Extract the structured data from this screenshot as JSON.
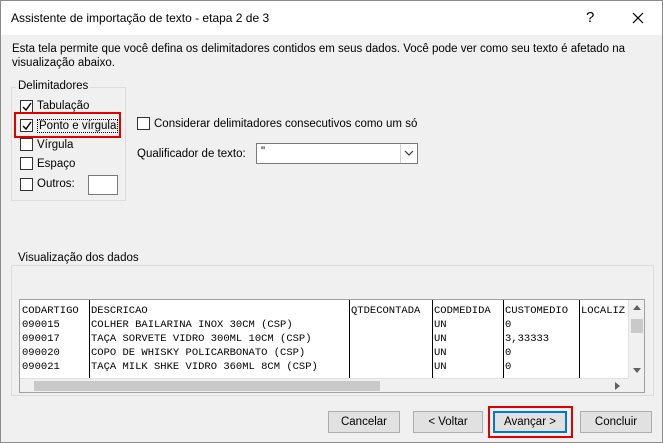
{
  "window": {
    "title": "Assistente de importação de texto - etapa 2 de 3",
    "help_glyph": "?",
    "close_glyph": "×"
  },
  "intro_text": "Esta tela permite que você defina os delimitadores contidos em seus dados. Você pode ver como seu texto é afetado na visualização abaixo.",
  "delimiters": {
    "group_label": "Delimitadores",
    "items": [
      {
        "label": "Tabulação",
        "checked": true
      },
      {
        "label": "Ponto e vírgula",
        "checked": true
      },
      {
        "label": "Vírgula",
        "checked": false
      },
      {
        "label": "Espaço",
        "checked": false
      },
      {
        "label": "Outros:",
        "checked": false
      }
    ],
    "others_value": ""
  },
  "consecutive": {
    "label": "Considerar delimitadores consecutivos como um só",
    "checked": false
  },
  "qualifier": {
    "label": "Qualificador de texto:",
    "value": "\""
  },
  "preview": {
    "group_label": "Visualização dos dados",
    "columns": [
      "CODARTIGO",
      "DESCRICAO",
      "QTDECONTADA",
      "CODMEDIDA",
      "CUSTOMEDIO",
      "LOCALIZ"
    ],
    "rows": [
      [
        "090015",
        "COLHER BAILARINA INOX 30CM (CSP)",
        "",
        "UN",
        "0",
        ""
      ],
      [
        "090017",
        "TAÇA SORVETE VIDRO 300ML 10CM (CSP)",
        "",
        "UN",
        "3,33333",
        ""
      ],
      [
        "090020",
        "COPO DE WHISKY POLICARBONATO (CSP)",
        "",
        "UN",
        "0",
        ""
      ],
      [
        "090021",
        "TAÇA MILK SHKE VIDRO 360ML 8CM (CSP)",
        "",
        "UN",
        "0",
        ""
      ]
    ]
  },
  "buttons": {
    "cancel": "Cancelar",
    "back": "< Voltar",
    "next": "Avançar >",
    "finish": "Concluir"
  },
  "highlight_color": "#e00000",
  "accent_color": "#0078d7"
}
